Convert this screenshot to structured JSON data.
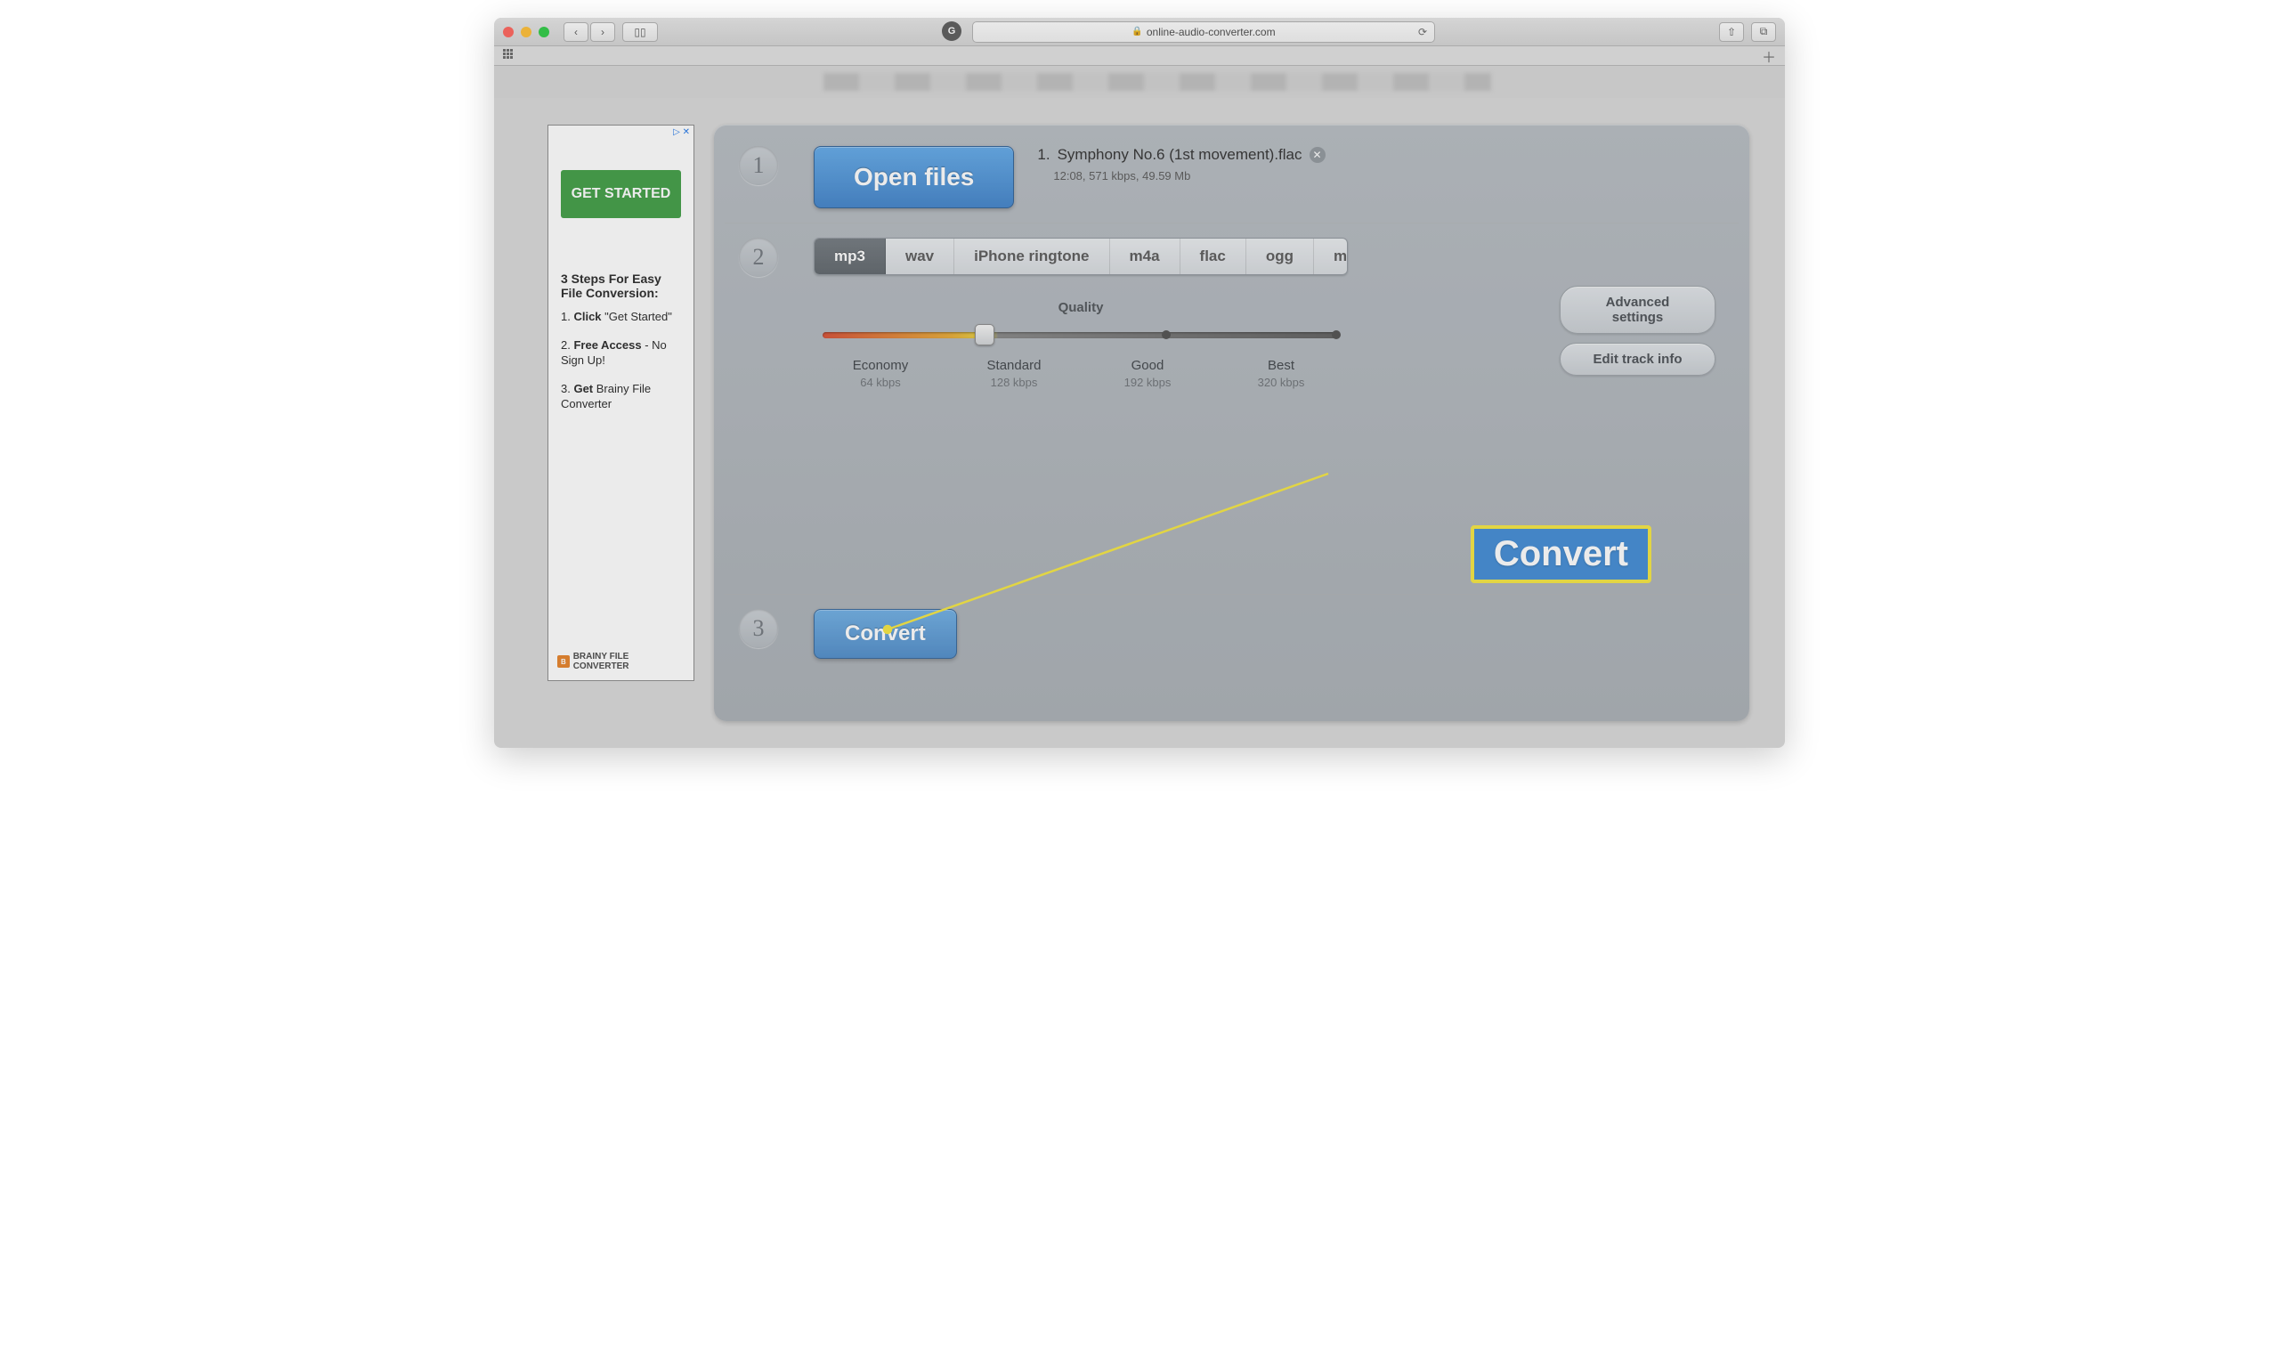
{
  "browser": {
    "url_display": "online-audio-converter.com",
    "favicon_letter": "G"
  },
  "ad": {
    "marker": "▷ ✕",
    "cta": "GET STARTED",
    "heading": "3 Steps For Easy File Conversion:",
    "step1_prefix": "1. ",
    "step1_bold": "Click",
    "step1_rest": " \"Get Started\"",
    "step2_prefix": "2. ",
    "step2_bold": "Free Access",
    "step2_rest": " - No Sign Up!",
    "step3_prefix": "3. ",
    "step3_bold": "Get",
    "step3_rest": " Brainy File Converter",
    "brand": "BRAINY FILE CONVERTER",
    "brand_icon": "B"
  },
  "step1": {
    "num": "1",
    "button": "Open files",
    "file_index": "1.",
    "filename": "Symphony No.6 (1st movement).flac",
    "meta": "12:08, 571 kbps, 49.59 Mb"
  },
  "step2": {
    "num": "2",
    "formats": {
      "mp3": "mp3",
      "wav": "wav",
      "iphone": "iPhone ringtone",
      "m4a": "m4a",
      "flac": "flac",
      "ogg": "ogg",
      "more": "more"
    },
    "quality_label": "Quality",
    "levels": [
      {
        "name": "Economy",
        "kbps": "64 kbps"
      },
      {
        "name": "Standard",
        "kbps": "128 kbps"
      },
      {
        "name": "Good",
        "kbps": "192 kbps"
      },
      {
        "name": "Best",
        "kbps": "320 kbps"
      }
    ],
    "advanced": "Advanced settings",
    "edit_track": "Edit track info"
  },
  "step3": {
    "num": "3",
    "button": "Convert"
  },
  "annotation": {
    "label": "Convert"
  }
}
